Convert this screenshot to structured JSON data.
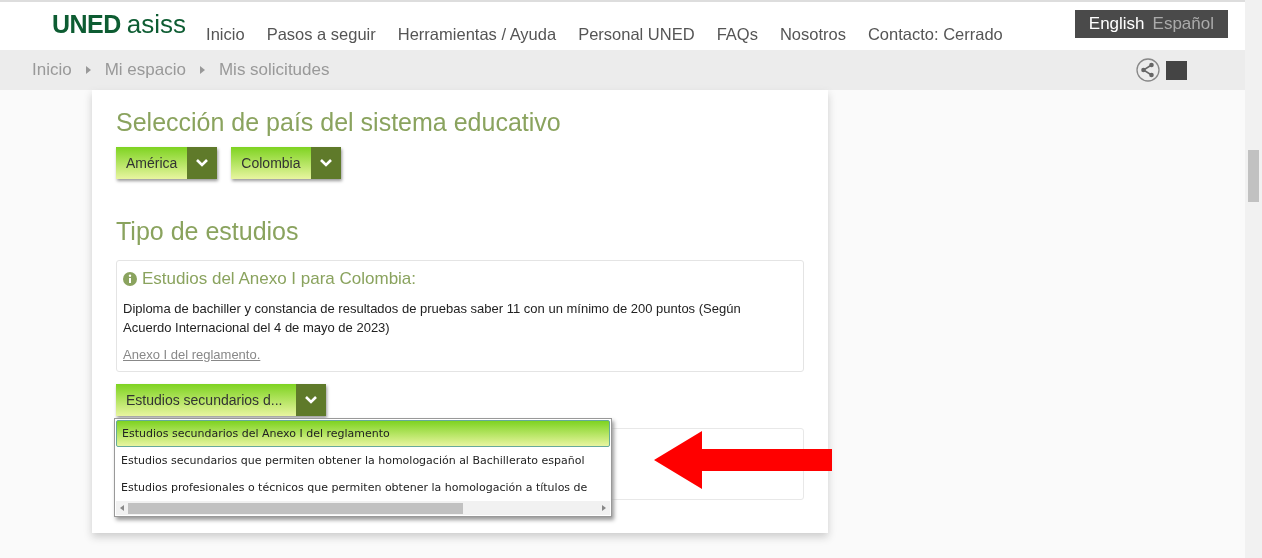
{
  "header": {
    "logo": {
      "brand": "UNED",
      "product": "asiss"
    },
    "nav": [
      "Inicio",
      "Pasos a seguir",
      "Herramientas / Ayuda",
      "Personal UNED",
      "FAQs",
      "Nosotros",
      "Contacto: Cerrado"
    ],
    "languages": [
      {
        "label": "English",
        "selected": true
      },
      {
        "label": "Español",
        "selected": false
      }
    ]
  },
  "breadcrumb": [
    "Inicio",
    "Mi espacio",
    "Mis solicitudes"
  ],
  "country_section": {
    "title": "Selección de país del sistema educativo",
    "selects": [
      "América",
      "Colombia"
    ]
  },
  "studies_section": {
    "title": "Tipo de estudios",
    "info": {
      "title": "Estudios del Anexo I para Colombia:",
      "text": "Diploma de bachiller y constancia de resultados de pruebas saber 11 con un mínimo de 200 puntos (Según Acuerdo Internacional del 4 de mayo de 2023)",
      "link": "Anexo I del reglamento."
    },
    "select": "Estudios secundarios d...",
    "options": [
      {
        "label": "Estudios secundarios del Anexo I del reglamento",
        "selected": true
      },
      {
        "label": "Estudios secundarios que permiten obtener la homologación al Bachillerato español",
        "selected": false
      },
      {
        "label": "Estudios profesionales o técnicos que permiten obtener la homologación a títulos de",
        "selected": false
      }
    ]
  }
}
